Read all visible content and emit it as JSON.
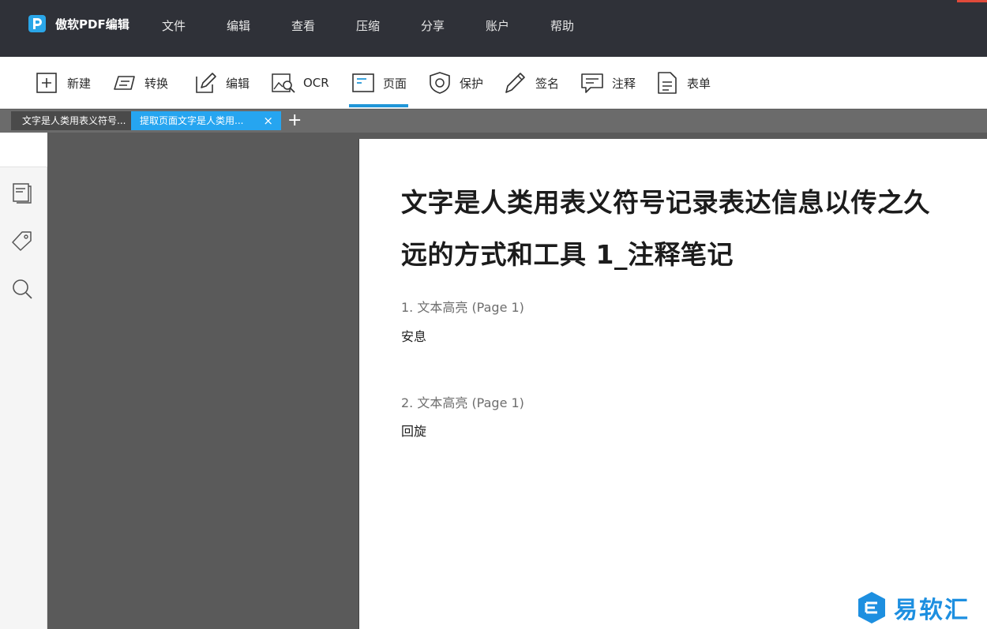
{
  "app": {
    "name": "傲软PDF编辑",
    "menu": [
      "文件",
      "编辑",
      "查看",
      "压缩",
      "分享",
      "账户",
      "帮助"
    ]
  },
  "toolbar": {
    "items": [
      {
        "label": "新建",
        "icon": "plus-box-icon"
      },
      {
        "label": "转换",
        "icon": "convert-icon"
      },
      {
        "label": "编辑",
        "icon": "edit-pencil-icon"
      },
      {
        "label": "OCR",
        "icon": "ocr-image-search-icon"
      },
      {
        "label": "页面",
        "icon": "page-icon"
      },
      {
        "label": "保护",
        "icon": "shield-icon"
      },
      {
        "label": "签名",
        "icon": "pen-signature-icon"
      },
      {
        "label": "注释",
        "icon": "comment-icon"
      },
      {
        "label": "表单",
        "icon": "form-icon"
      }
    ],
    "active": "页面"
  },
  "tabs": [
    {
      "label": "文字是人类用表义符号...",
      "active": false
    },
    {
      "label": "提取页面文字是人类用...",
      "active": true,
      "close": "×"
    }
  ],
  "tab_add": "+",
  "sidebar": {
    "icons": [
      "pages-thumbnail-icon",
      "bookmark-tag-icon",
      "search-icon"
    ]
  },
  "document": {
    "title": "文字是人类用表义符号记录表达信息以传之久远的方式和工具 1_注释笔记",
    "notes": [
      {
        "header": "1. 文本高亮 (Page 1)",
        "text": "安息"
      },
      {
        "header": "2. 文本高亮 (Page 1)",
        "text": "回旋"
      }
    ]
  },
  "watermark": {
    "text": "易软汇"
  },
  "colors": {
    "menubar_bg": "#2f3138",
    "accent": "#2196d8",
    "active_tab": "#26a5f0",
    "canvas_bg": "#5a5a5a",
    "watermark": "#1d8fe0"
  }
}
